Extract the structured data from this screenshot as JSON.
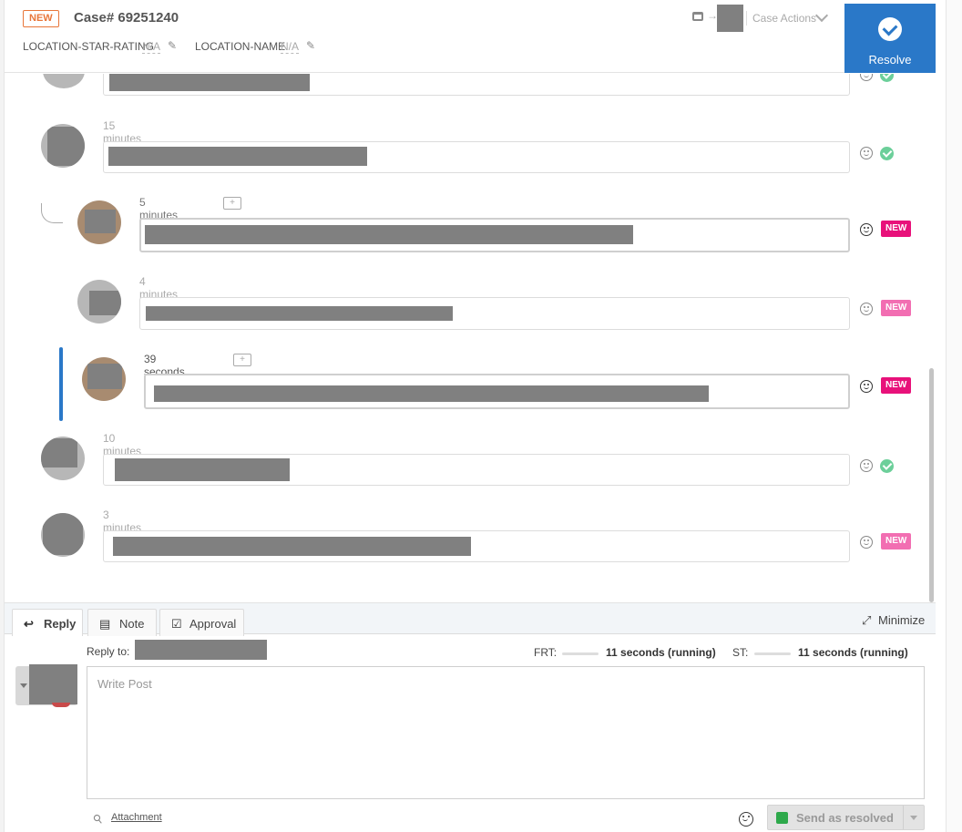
{
  "header": {
    "status_badge": "NEW",
    "case_title": "Case# 69251240",
    "fields": [
      {
        "label": "LOCATION-STAR-RATING",
        "value": "N/A"
      },
      {
        "label": "LOCATION-NAME",
        "value": "N/A"
      }
    ],
    "case_actions_label": "Case Actions",
    "resolve_label": "Resolve"
  },
  "messages": [
    {
      "time": "",
      "status": "ok"
    },
    {
      "time": "15 minutes ago",
      "status": "ok"
    },
    {
      "time": "5 minutes ago",
      "status": "NEW"
    },
    {
      "time": "4 minutes ago",
      "status": "NEW"
    },
    {
      "time": "39 seconds ago",
      "status": "NEW"
    },
    {
      "time": "10 minutes ago",
      "status": "ok"
    },
    {
      "time": "3 minutes ago",
      "status": "NEW"
    }
  ],
  "composer": {
    "tabs": [
      {
        "label": "Reply",
        "icon": "reply-arrow-icon"
      },
      {
        "label": "Note",
        "icon": "note-icon"
      },
      {
        "label": "Approval",
        "icon": "approval-check-icon"
      }
    ],
    "minimize_label": "Minimize",
    "reply_to_label": "Reply to:",
    "frt_label": "FRT:",
    "frt_value": "11 seconds (running)",
    "st_label": "ST:",
    "st_value": "11 seconds (running)",
    "placeholder": "Write Post",
    "attachment_label": "Attachment",
    "send_label": "Send as resolved"
  },
  "colors": {
    "accent": "#2a78c8",
    "new_hot": "#e8117a",
    "new_soft": "#f26eb2",
    "ok_green": "#6ccf9a",
    "badge_orange": "#e8763a"
  }
}
